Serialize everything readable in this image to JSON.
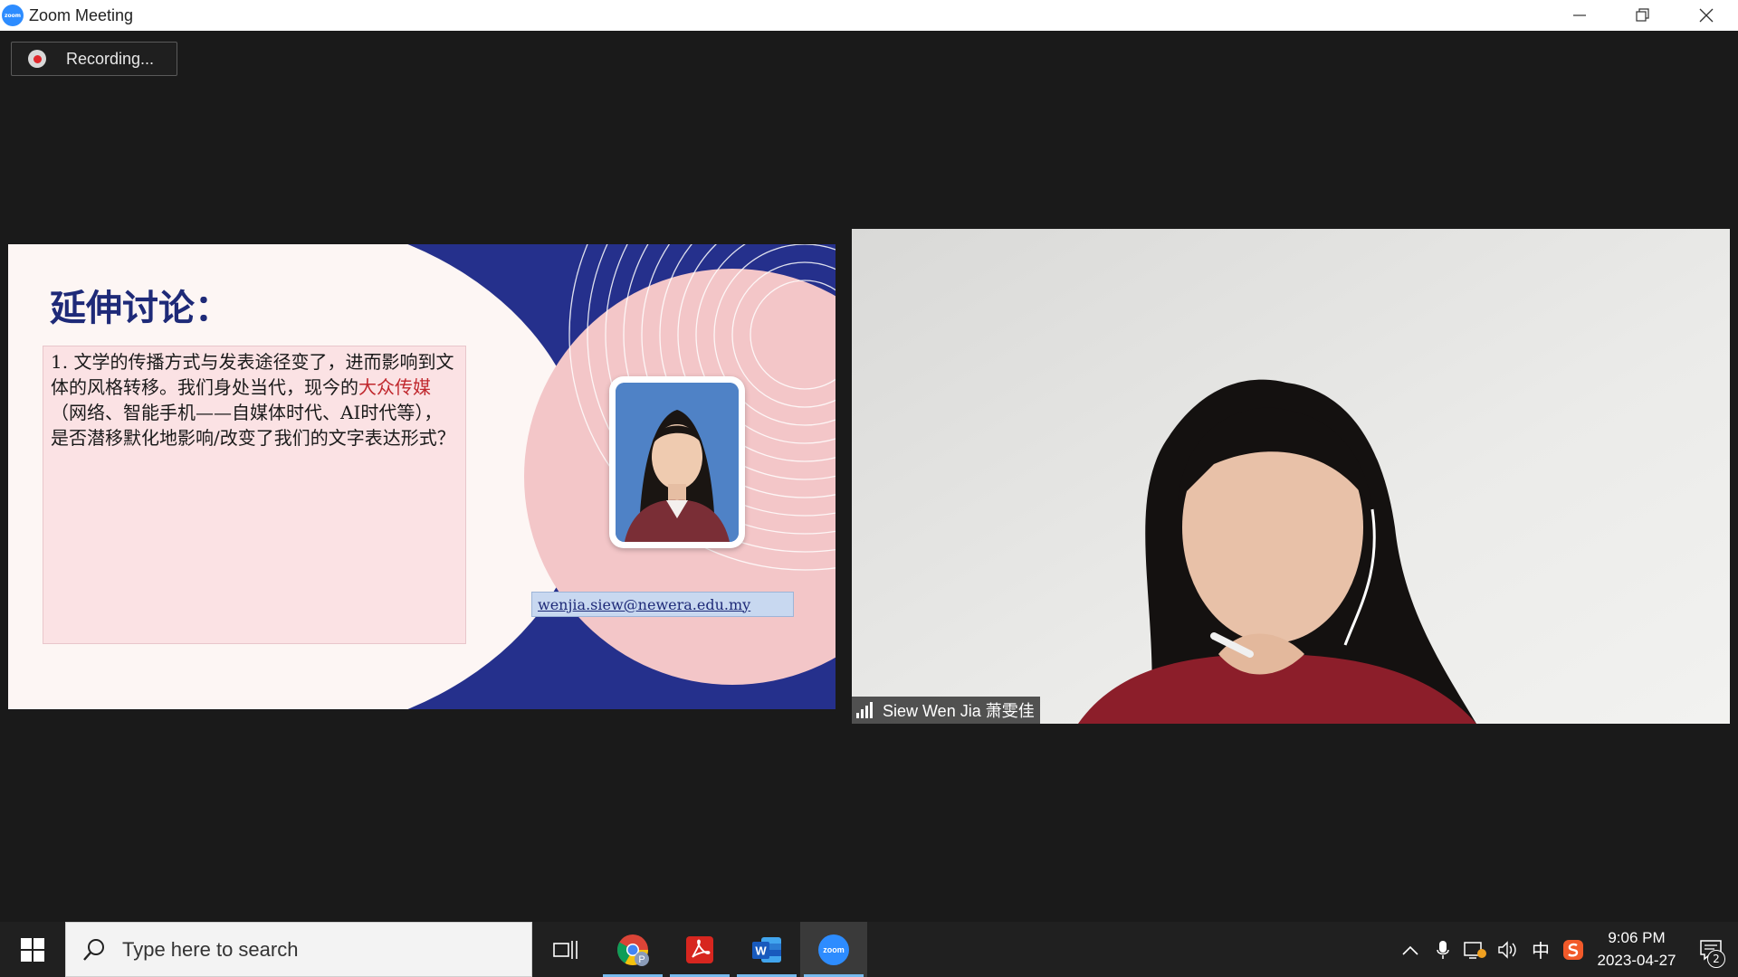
{
  "window": {
    "title": "Zoom Meeting",
    "logo_text": "zoom"
  },
  "recording": {
    "label": "Recording..."
  },
  "slide": {
    "title": "延伸讨论：",
    "paragraph": {
      "before": "1. 文学的传播方式与发表途径变了，进而影响到文体的风格转移。我们身处当代，现今的",
      "highlight": "大众传媒",
      "after": "（网络、智能手机——自媒体时代、AI时代等），是否潜移默化地影响/改变了我们的文字表达形式？"
    },
    "email": "wenjia.siew@newera.edu.my",
    "colors": {
      "navy": "#25308c",
      "pink": "#f3c6c8",
      "title": "#1e2a78",
      "highlight": "#c0272d"
    }
  },
  "video": {
    "participant_name": "Siew Wen Jia 萧雯佳"
  },
  "taskbar": {
    "search_placeholder": "Type here to search",
    "apps": [
      {
        "name": "task-view-icon"
      },
      {
        "name": "chrome-icon",
        "badge": "P"
      },
      {
        "name": "adobe-acrobat-icon"
      },
      {
        "name": "word-icon",
        "letter": "W"
      },
      {
        "name": "zoom-icon",
        "text": "zoom"
      }
    ],
    "tray": {
      "ime": "中",
      "time": "9:06 PM",
      "date": "2023-04-27",
      "notification_count": "2"
    }
  }
}
